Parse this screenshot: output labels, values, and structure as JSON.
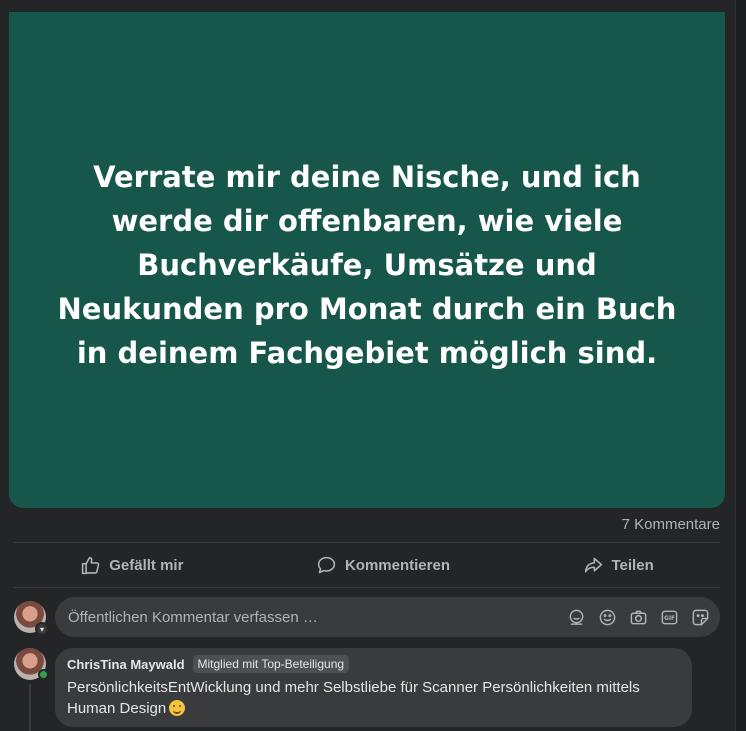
{
  "post": {
    "image_text": "Verrate mir deine Nische, und ich werde dir offenbaren, wie viele Buchverkäufe, Umsätze und Neukunden pro Monat durch ein Buch in deinem Fachgebiet möglich sind.",
    "image_bg_color": "#17564a",
    "comment_count": "7 Kommentare"
  },
  "actions": {
    "like_label": "Gefällt mir",
    "comment_label": "Kommentieren",
    "share_label": "Teilen"
  },
  "composer": {
    "placeholder": "Öffentlichen Kommentar verfassen …",
    "icons": [
      "avatar-sticker-icon",
      "emoji-icon",
      "camera-icon",
      "gif-icon",
      "sticker-icon"
    ]
  },
  "comments": [
    {
      "author": "ChrisTina Maywald",
      "badge": "Mitglied mit Top-Beteiligung",
      "text": "PersönlichkeitsEntWicklung und mehr Selbstliebe für Scanner Persönlichkeiten mittels Human Design",
      "online": true
    }
  ],
  "colors": {
    "background": "#242526",
    "input_bg": "#3a3b3c",
    "muted_text": "#b0b3b8",
    "online": "#31a24c"
  }
}
